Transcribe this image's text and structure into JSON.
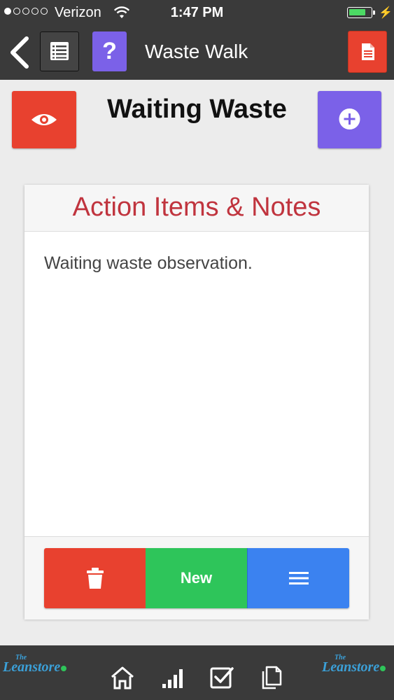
{
  "status_bar": {
    "carrier": "Verizon",
    "time": "1:47 PM",
    "signal_bars_filled": 1,
    "signal_bars_total": 5,
    "battery_level": 0.8
  },
  "nav": {
    "title": "Waste Walk",
    "help_label": "?",
    "icons": [
      "chevron-left-icon",
      "list-icon",
      "question-icon",
      "document-icon"
    ]
  },
  "header": {
    "title": "Waiting Waste",
    "icons": [
      "eye-icon",
      "plus-circle-icon"
    ]
  },
  "card": {
    "title": "Action Items & Notes",
    "note": "Waiting waste observation.",
    "buttons": {
      "new_label": "New",
      "icons": [
        "trash-icon",
        "menu-icon"
      ]
    }
  },
  "tab_bar": {
    "logo_small": "The",
    "logo_text": "Leanstore",
    "tabs": [
      "home-icon",
      "bar-chart-icon",
      "checkbox-icon",
      "documents-icon"
    ]
  },
  "colors": {
    "bar_dark": "#3a3a3a",
    "red": "#e8412f",
    "purple": "#7b61e8",
    "green": "#2ec55a",
    "blue": "#3b82f0",
    "title_red": "#c0343e",
    "battery_green": "#4cd964"
  }
}
